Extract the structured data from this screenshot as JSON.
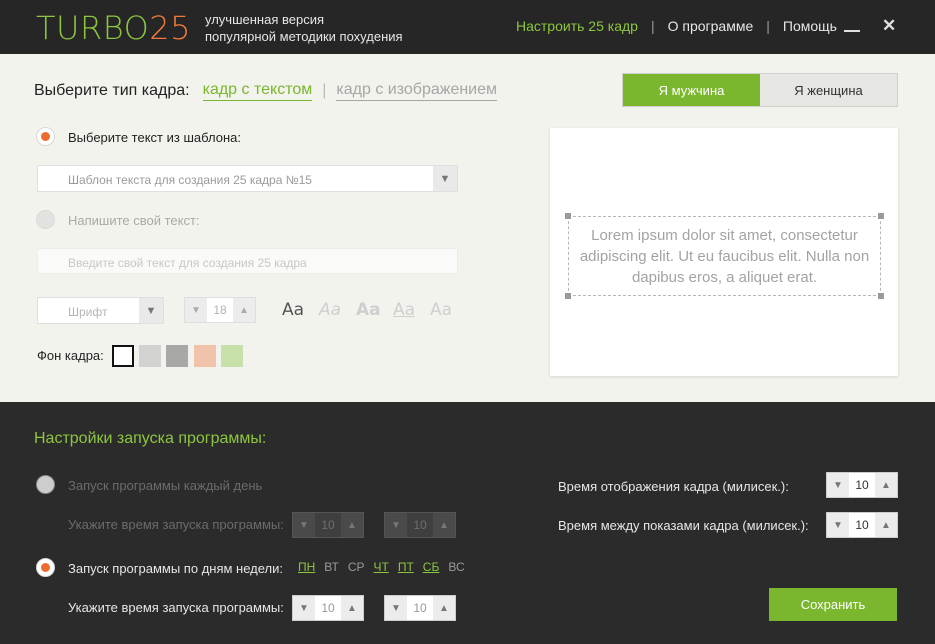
{
  "header": {
    "logo_text": "TURBO",
    "logo_num": "25",
    "tagline_line1": "улучшенная версия",
    "tagline_line2": "популярной методики похудения",
    "nav": {
      "configure": "Настроить 25 кадр",
      "about": "О программе",
      "help": "Помощь"
    },
    "separator": "|"
  },
  "frame_type": {
    "label": "Выберите тип кадра:",
    "text_option": "кадр с текстом",
    "image_option": "кадр с изображением",
    "separator": "|"
  },
  "gender": {
    "male": "Я мужчина",
    "female": "Я женщина"
  },
  "template": {
    "label": "Выберите текст из шаблона:",
    "selected": "Шаблон текста для создания 25 кадра №15"
  },
  "custom": {
    "label": "Напишите свой текст:",
    "placeholder": "Введите свой текст для создания 25 кадра"
  },
  "font": {
    "family": "Шрифт",
    "size": "18",
    "styles": [
      "Aa",
      "Aa",
      "Aa",
      "Aa",
      "Aa"
    ]
  },
  "background": {
    "label": "Фон кадра:",
    "colors": [
      "#ffffff",
      "#d2d2d0",
      "#a8a8a6",
      "#f2c3ab",
      "#c7dfa8"
    ]
  },
  "preview": {
    "text": "Lorem ipsum dolor sit amet, consectetur adipiscing elit. Ut eu faucibus elit. Nulla non dapibus eros, a aliquet erat."
  },
  "launch": {
    "title": "Настройки запуска программы:",
    "daily_label": "Запуск программы каждый день",
    "time_label": "Укажите время запуска программы:",
    "daily_hour": "10",
    "daily_min": "10",
    "weekdays_label": "Запуск программы по дням недели:",
    "days": [
      {
        "name": "ПН",
        "active": true
      },
      {
        "name": "ВТ",
        "active": false
      },
      {
        "name": "СР",
        "active": false
      },
      {
        "name": "ЧТ",
        "active": true
      },
      {
        "name": "ПТ",
        "active": true
      },
      {
        "name": "СБ",
        "active": true
      },
      {
        "name": "ВС",
        "active": false
      }
    ],
    "weekly_hour": "10",
    "weekly_min": "10",
    "display_time_label": "Время отображения кадра (милисек.):",
    "display_time": "10",
    "interval_label": "Время между показами кадра (милисек.):",
    "interval": "10",
    "save": "Сохранить"
  },
  "colors": {
    "accent_green": "#7ab62e",
    "accent_orange": "#ec6b2d",
    "dark_bg": "#2b2b2b"
  }
}
